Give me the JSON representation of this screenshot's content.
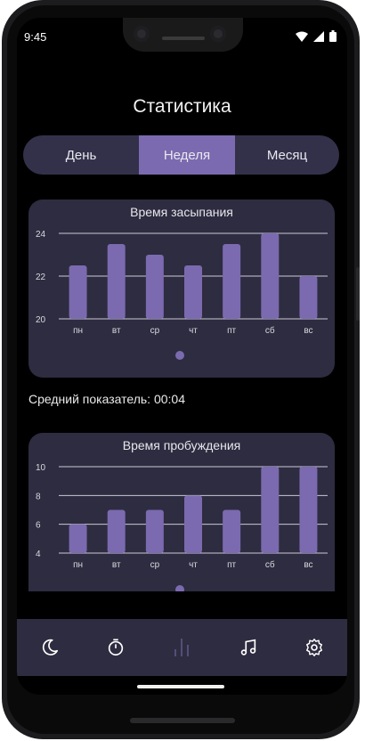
{
  "status_bar": {
    "time": "9:45",
    "icons": [
      "wifi-icon",
      "signal-icon",
      "battery-icon"
    ]
  },
  "header": {
    "title": "Статистика"
  },
  "period_tabs": [
    {
      "label": "День",
      "active": false
    },
    {
      "label": "Неделя",
      "active": true
    },
    {
      "label": "Месяц",
      "active": false
    }
  ],
  "sleep_card": {
    "title": "Время засыпания",
    "average_label": "Средний показатель: 00:04"
  },
  "wake_card": {
    "title": "Время пробуждения"
  },
  "bottom_nav": {
    "items": [
      {
        "icon": "moon-icon",
        "active": false
      },
      {
        "icon": "timer-icon",
        "active": false
      },
      {
        "icon": "stats-icon",
        "active": true
      },
      {
        "icon": "music-icon",
        "active": false
      },
      {
        "icon": "settings-icon",
        "active": false
      }
    ]
  },
  "colors": {
    "accent": "#7b6aaf",
    "card": "#2e2c40",
    "segment_bg": "#33314a",
    "background": "#000000"
  },
  "chart_data": [
    {
      "type": "bar",
      "title": "Время засыпания",
      "categories": [
        "пн",
        "вт",
        "ср",
        "чт",
        "пт",
        "сб",
        "вс"
      ],
      "values": [
        22.5,
        23.5,
        23,
        22.5,
        23.5,
        24,
        22
      ],
      "yticks": [
        20,
        22,
        24
      ],
      "ylim": [
        20,
        24
      ],
      "grid": true
    },
    {
      "type": "bar",
      "title": "Время пробуждения",
      "categories": [
        "пн",
        "вт",
        "ср",
        "чт",
        "пт",
        "сб",
        "вс"
      ],
      "values": [
        6,
        7,
        7,
        8,
        7,
        10,
        10
      ],
      "yticks": [
        4,
        6,
        8,
        10
      ],
      "ylim": [
        4,
        10
      ],
      "grid": true
    }
  ]
}
